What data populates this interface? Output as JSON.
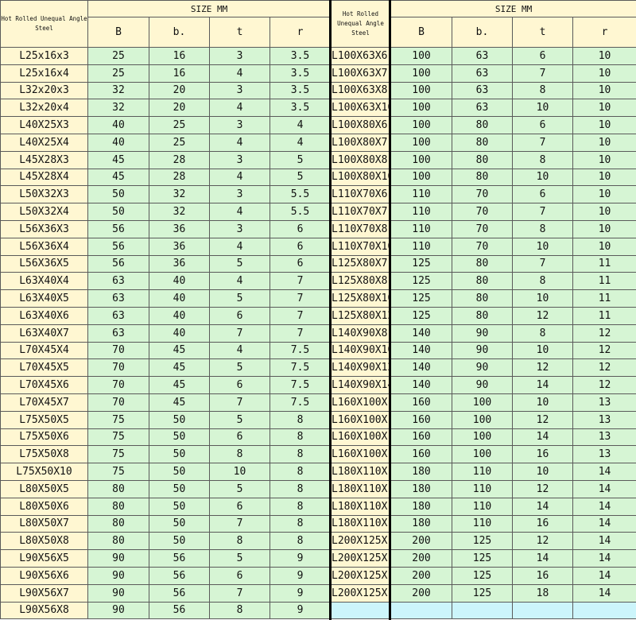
{
  "header": {
    "size_label": "SIZE MM",
    "spec_label": "Hot Rolled Unequal Angle Steel",
    "columns": [
      "B",
      "b.",
      "t",
      "r"
    ]
  },
  "left_rows": [
    [
      "L25x16x3",
      "25",
      "16",
      "3",
      "3.5"
    ],
    [
      "L25x16x4",
      "25",
      "16",
      "4",
      "3.5"
    ],
    [
      "L32x20x3",
      "32",
      "20",
      "3",
      "3.5"
    ],
    [
      "L32x20x4",
      "32",
      "20",
      "4",
      "3.5"
    ],
    [
      "L40X25X3",
      "40",
      "25",
      "3",
      "4"
    ],
    [
      "L40X25X4",
      "40",
      "25",
      "4",
      "4"
    ],
    [
      "L45X28X3",
      "45",
      "28",
      "3",
      "5"
    ],
    [
      "L45X28X4",
      "45",
      "28",
      "4",
      "5"
    ],
    [
      "L50X32X3",
      "50",
      "32",
      "3",
      "5.5"
    ],
    [
      "L50X32X4",
      "50",
      "32",
      "4",
      "5.5"
    ],
    [
      "L56X36X3",
      "56",
      "36",
      "3",
      "6"
    ],
    [
      "L56X36X4",
      "56",
      "36",
      "4",
      "6"
    ],
    [
      "L56X36X5",
      "56",
      "36",
      "5",
      "6"
    ],
    [
      "L63X40X4",
      "63",
      "40",
      "4",
      "7"
    ],
    [
      "L63X40X5",
      "63",
      "40",
      "5",
      "7"
    ],
    [
      "L63X40X6",
      "63",
      "40",
      "6",
      "7"
    ],
    [
      "L63X40X7",
      "63",
      "40",
      "7",
      "7"
    ],
    [
      "L70X45X4",
      "70",
      "45",
      "4",
      "7.5"
    ],
    [
      "L70X45X5",
      "70",
      "45",
      "5",
      "7.5"
    ],
    [
      "L70X45X6",
      "70",
      "45",
      "6",
      "7.5"
    ],
    [
      "L70X45X7",
      "70",
      "45",
      "7",
      "7.5"
    ],
    [
      "L75X50X5",
      "75",
      "50",
      "5",
      "8"
    ],
    [
      "L75X50X6",
      "75",
      "50",
      "6",
      "8"
    ],
    [
      "L75X50X8",
      "75",
      "50",
      "8",
      "8"
    ],
    [
      "L75X50X10",
      "75",
      "50",
      "10",
      "8"
    ],
    [
      "L80X50X5",
      "80",
      "50",
      "5",
      "8"
    ],
    [
      "L80X50X6",
      "80",
      "50",
      "6",
      "8"
    ],
    [
      "L80X50X7",
      "80",
      "50",
      "7",
      "8"
    ],
    [
      "L80X50X8",
      "80",
      "50",
      "8",
      "8"
    ],
    [
      "L90X56X5",
      "90",
      "56",
      "5",
      "9"
    ],
    [
      "L90X56X6",
      "90",
      "56",
      "6",
      "9"
    ],
    [
      "L90X56X7",
      "90",
      "56",
      "7",
      "9"
    ],
    [
      "L90X56X8",
      "90",
      "56",
      "8",
      "9"
    ]
  ],
  "right_rows": [
    [
      "L100X63X6",
      "100",
      "63",
      "6",
      "10"
    ],
    [
      "L100X63X7",
      "100",
      "63",
      "7",
      "10"
    ],
    [
      "L100X63X8",
      "100",
      "63",
      "8",
      "10"
    ],
    [
      "L100X63X10",
      "100",
      "63",
      "10",
      "10"
    ],
    [
      "L100X80X6",
      "100",
      "80",
      "6",
      "10"
    ],
    [
      "L100X80X7",
      "100",
      "80",
      "7",
      "10"
    ],
    [
      "L100X80X8",
      "100",
      "80",
      "8",
      "10"
    ],
    [
      "L100X80X10",
      "100",
      "80",
      "10",
      "10"
    ],
    [
      "L110X70X6",
      "110",
      "70",
      "6",
      "10"
    ],
    [
      "L110X70X7",
      "110",
      "70",
      "7",
      "10"
    ],
    [
      "L110X70X8",
      "110",
      "70",
      "8",
      "10"
    ],
    [
      "L110X70X10",
      "110",
      "70",
      "10",
      "10"
    ],
    [
      "L125X80X7",
      "125",
      "80",
      "7",
      "11"
    ],
    [
      "L125X80X8",
      "125",
      "80",
      "8",
      "11"
    ],
    [
      "L125X80X10",
      "125",
      "80",
      "10",
      "11"
    ],
    [
      "L125X80X12",
      "125",
      "80",
      "12",
      "11"
    ],
    [
      "L140X90X8",
      "140",
      "90",
      "8",
      "12"
    ],
    [
      "L140X90X10",
      "140",
      "90",
      "10",
      "12"
    ],
    [
      "L140X90X12",
      "140",
      "90",
      "12",
      "12"
    ],
    [
      "L140X90X14",
      "140",
      "90",
      "14",
      "12"
    ],
    [
      "L160X100X10",
      "160",
      "100",
      "10",
      "13"
    ],
    [
      "L160X100X12",
      "160",
      "100",
      "12",
      "13"
    ],
    [
      "L160X100X14",
      "160",
      "100",
      "14",
      "13"
    ],
    [
      "L160X100X16",
      "160",
      "100",
      "16",
      "13"
    ],
    [
      "L180X110X10",
      "180",
      "110",
      "10",
      "14"
    ],
    [
      "L180X110X12",
      "180",
      "110",
      "12",
      "14"
    ],
    [
      "L180X110X14",
      "180",
      "110",
      "14",
      "14"
    ],
    [
      "L180X110X16",
      "180",
      "110",
      "16",
      "14"
    ],
    [
      "L200X125X12",
      "200",
      "125",
      "12",
      "14"
    ],
    [
      "L200X125X14",
      "200",
      "125",
      "14",
      "14"
    ],
    [
      "L200X125X16",
      "200",
      "125",
      "16",
      "14"
    ],
    [
      "L200X125X18",
      "200",
      "125",
      "18",
      "14"
    ]
  ]
}
